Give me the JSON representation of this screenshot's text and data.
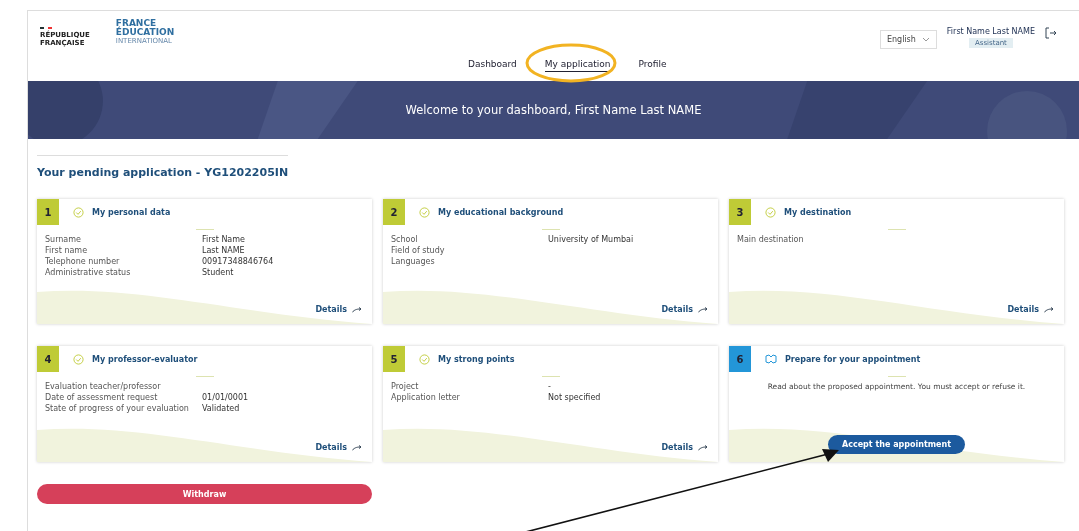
{
  "header": {
    "logo_left": [
      "RÉPUBLIQUE",
      "FRANÇAISE"
    ],
    "logo_right": {
      "line1": "FRANCE",
      "line2": "ÉDUCATION",
      "line3": "INTERNATIONAL"
    },
    "language": "English",
    "user": {
      "name": "First Name Last NAME",
      "role": "Assistant"
    }
  },
  "tabs": [
    {
      "label": "Dashboard",
      "selected": false
    },
    {
      "label": "My application",
      "selected": true
    },
    {
      "label": "Profile",
      "selected": false
    }
  ],
  "banner": {
    "title": "Welcome to your dashboard, First Name Last NAME"
  },
  "section_title": "Your pending application - YG1202205IN",
  "cards": [
    {
      "number": "1",
      "title": "My personal data",
      "kind": "done",
      "rows": [
        {
          "label": "Surname",
          "value": "First Name"
        },
        {
          "label": "First name",
          "value": "Last NAME"
        },
        {
          "label": "Telephone number",
          "value": "00917348846764"
        },
        {
          "label": "Administrative status",
          "value": "Student"
        }
      ],
      "link": "Details"
    },
    {
      "number": "2",
      "title": "My educational background",
      "kind": "done",
      "rows": [
        {
          "label": "School",
          "value": "University of Mumbai"
        },
        {
          "label": "Field of study"
        },
        {
          "label": "Languages"
        }
      ],
      "link": "Details"
    },
    {
      "number": "3",
      "title": "My destination",
      "kind": "done",
      "rows": [
        {
          "label": "Main destination"
        }
      ],
      "link": "Details"
    },
    {
      "number": "4",
      "title": "My professor-evaluator",
      "kind": "done",
      "rows": [
        {
          "label": "Evaluation teacher/professor"
        },
        {
          "label": "Date of assessment request",
          "value": "01/01/0001"
        },
        {
          "label": "State of progress of your evaluation",
          "value": "Validated"
        }
      ],
      "link": "Details"
    },
    {
      "number": "5",
      "title": "My strong points",
      "kind": "done",
      "rows": [
        {
          "label": "Project",
          "value": "-"
        },
        {
          "label": "Application letter",
          "value": "Not specified"
        }
      ],
      "link": "Details"
    },
    {
      "number": "6",
      "title": "Prepare for your appointment",
      "kind": "current",
      "message": "Read about the proposed appointment. You must accept or refuse it.",
      "button": "Accept the appointment"
    }
  ],
  "withdraw_button": "Withdraw"
}
